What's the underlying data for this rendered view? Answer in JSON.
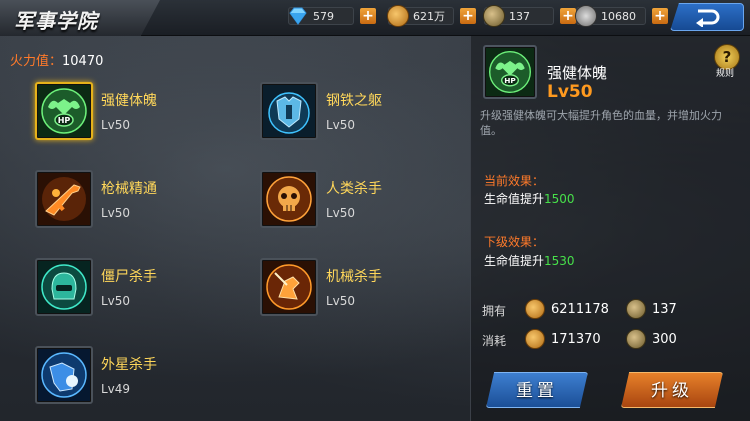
{
  "header": {
    "title": "军事学院",
    "resources": [
      {
        "icon": "diamond-icon",
        "value": "579"
      },
      {
        "icon": "gold-coin-icon",
        "value": "621万"
      },
      {
        "icon": "medal-icon",
        "value": "137"
      },
      {
        "icon": "badge-icon",
        "value": "10680"
      }
    ]
  },
  "firepower": {
    "label": "火力值：",
    "value": "10470"
  },
  "skills": [
    {
      "name": "强健体魄",
      "level": "Lv50",
      "icon": "hp-muscle-icon",
      "selected": true
    },
    {
      "name": "钢铁之躯",
      "level": "Lv50",
      "icon": "armor-icon"
    },
    {
      "name": "枪械精通",
      "level": "Lv50",
      "icon": "rifle-icon"
    },
    {
      "name": "人类杀手",
      "level": "Lv50",
      "icon": "skull-icon"
    },
    {
      "name": "僵尸杀手",
      "level": "Lv50",
      "icon": "zombie-helmet-icon"
    },
    {
      "name": "机械杀手",
      "level": "Lv50",
      "icon": "mech-icon"
    },
    {
      "name": "外星杀手",
      "level": "Lv49",
      "icon": "alien-armor-icon"
    }
  ],
  "detail": {
    "name": "强健体魄",
    "level": "Lv50",
    "description": "升级强健体魄可大幅提升角色的血量，并增加火力值。",
    "help_label": "规则",
    "current_effect_title": "当前效果：",
    "current_effect_text": "生命值提升",
    "current_effect_value": "1500",
    "next_effect_title": "下级效果：",
    "next_effect_text": "生命值提升",
    "next_effect_value": "1530",
    "own_label": "拥有",
    "own_gold": "6211178",
    "own_medal": "137",
    "cost_label": "消耗",
    "cost_gold": "171370",
    "cost_medal": "300"
  },
  "buttons": {
    "reset": "重置",
    "upgrade": "升级"
  },
  "colors": {
    "accent_orange": "#ff7a2a",
    "level_orange": "#ff9a1f",
    "skill_name": "#ffd75a",
    "effect_green": "#47e04a",
    "select_gold": "#e6b21a"
  }
}
